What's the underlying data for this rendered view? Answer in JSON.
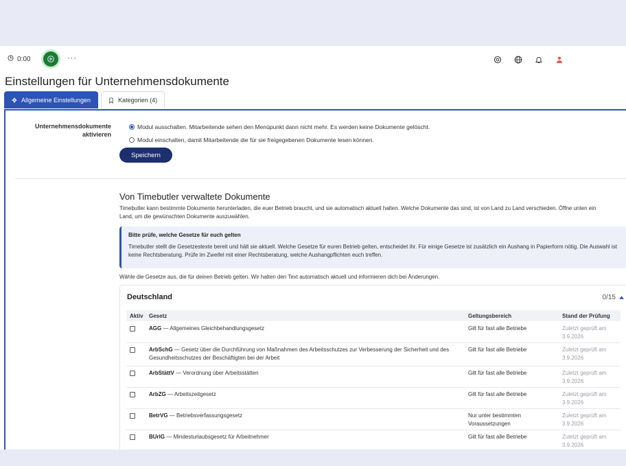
{
  "toolbar": {
    "timer": "0:00",
    "more": "···"
  },
  "page": {
    "title": "Einstellungen für Unternehmensdokumente"
  },
  "tabs": [
    {
      "label": "Allgemeine Einstellungen",
      "active": true
    },
    {
      "label": "Kategorien (4)",
      "active": false
    }
  ],
  "module": {
    "label": "Unternehmensdokumente aktivieren",
    "option_off": "Modul ausschalten. Mitarbeitende sehen den Menüpunkt dann nicht mehr. Es werden keine Dokumente gelöscht.",
    "option_on": "Modul einschalten, damit Mitarbeitende die für sie freigegebenen Dokumente lesen können.",
    "selected": "off",
    "save_label": "Speichern"
  },
  "managed": {
    "title": "Von Timebutler verwaltete Dokumente",
    "description": "Timebutler kann bestimmte Dokumente herunterladen, die euer Betrieb braucht, und sie automatisch aktuell halten. Welche Dokumente das sind, ist von Land zu Land verschieden. Öffne unten ein Land, um die gewünschten Dokumente auszuwählen.",
    "notice_title": "Bitte prüfe, welche Gesetze für euch gelten",
    "notice_body": "Timebutler stellt die Gesetzestexte bereit und hält sie aktuell. Welche Gesetze für euren Betrieb gelten, entscheidet ihr. Für einige Gesetze ist zusätzlich ein Aushang in Papierform nötig. Die Auswahl ist keine Rechtsberatung. Prüfe im Zweifel mit einer Rechtsberatung, welche Aushangpflichten euch treffen.",
    "choose_text": "Wähle die Gesetze aus, die für deinen Betrieb gelten. Wir halten den Text automatisch aktuell und informieren dich bei Änderungen."
  },
  "country": {
    "name": "Deutschland",
    "count": "0/15",
    "columns": {
      "active": "Aktiv",
      "law": "Gesetz",
      "scope": "Geltungsbereich",
      "checked": "Stand der Prüfung"
    },
    "rows": [
      {
        "abbr": "AGG",
        "name": " — Allgemeines Gleichbehandlungsgesetz",
        "scope": "Gilt für fast alle Betriebe",
        "checked": "Zuletzt geprüft am 3.9.2026"
      },
      {
        "abbr": "ArbSchG",
        "name": " — Gesetz über die Durchführung von Maßnahmen des Arbeitsschutzes zur Verbesserung der Sicherheit und des Gesundheitsschutzes der Beschäftigten bei der Arbeit",
        "scope": "Gilt für fast alle Betriebe",
        "checked": "Zuletzt geprüft am 3.9.2026"
      },
      {
        "abbr": "ArbStättV",
        "name": " — Verordnung über Arbeitsstätten",
        "scope": "Gilt für fast alle Betriebe",
        "checked": "Zuletzt geprüft am 3.9.2026"
      },
      {
        "abbr": "ArbZG",
        "name": " — Arbeitszeitgesetz",
        "scope": "Gilt für fast alle Betriebe",
        "checked": "Zuletzt geprüft am 3.9.2026"
      },
      {
        "abbr": "BetrVG",
        "name": " — Betriebsverfassungsgesetz",
        "scope": "Nur unter bestimmten Voraussetzungen",
        "checked": "Zuletzt geprüft am 3.9.2026"
      },
      {
        "abbr": "BUrlG",
        "name": " — Mindesturlaubsgesetz für Arbeitnehmer",
        "scope": "Gilt für fast alle Betriebe",
        "checked": "Zuletzt geprüft am 3.9.2026"
      }
    ]
  },
  "colors": {
    "accent": "#2c53b6",
    "button": "#1e2f6e",
    "play": "#1b7a35",
    "user": "#e05a5a"
  }
}
